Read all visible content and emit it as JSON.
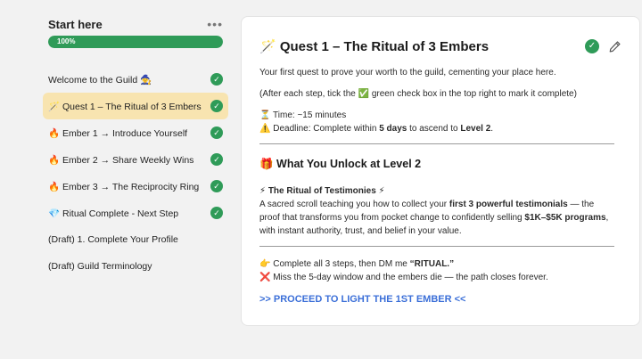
{
  "sidebar": {
    "title": "Start here",
    "more_icon": "•••",
    "progress": {
      "percent": 100,
      "label": "100%"
    },
    "items": [
      {
        "label": "Welcome to the Guild 🧙",
        "done": true,
        "active": false
      },
      {
        "label": "🪄 Quest 1 – The Ritual of 3 Embers",
        "done": true,
        "active": true
      },
      {
        "label": "🔥 Ember 1 → Introduce Yourself",
        "done": true,
        "active": false
      },
      {
        "label": "🔥 Ember 2 → Share Weekly Wins",
        "done": true,
        "active": false
      },
      {
        "label": "🔥 Ember 3 → The Reciprocity Ring",
        "done": true,
        "active": false
      },
      {
        "label": "💎 Ritual Complete - Next Step",
        "done": true,
        "active": false
      },
      {
        "label": "(Draft) 1. Complete Your Profile",
        "done": false,
        "active": false
      },
      {
        "label": "(Draft) Guild Terminology",
        "done": false,
        "active": false
      }
    ],
    "check_glyph": "✓"
  },
  "lesson": {
    "title": "🪄 Quest 1 – The Ritual of 3 Embers",
    "check_glyph": "✓",
    "intro": "Your first quest to prove your worth to the guild, cementing your place here.",
    "instruction": "(After each step, tick the ✅ green check box in the top right to mark it complete)",
    "time": "⏳ Time: ~15 minutes",
    "deadline_pre": "⚠️ Deadline: Complete within ",
    "deadline_days": "5 days",
    "deadline_mid": " to ascend to ",
    "deadline_level": "Level 2",
    "deadline_end": ".",
    "unlock_heading": "🎁 What You Unlock at Level 2",
    "testimonies_pre": "⚡ ",
    "testimonies_title": "The Ritual of Testimonies",
    "testimonies_post": " ⚡",
    "scroll_pre": "A sacred scroll teaching you how to collect your ",
    "scroll_bold1": "first 3 powerful testimonials",
    "scroll_mid": " — the proof that transforms you from pocket change to confidently selling ",
    "scroll_bold2": "$1K–$5K programs",
    "scroll_end": ", with instant authority, trust, and belief in your value.",
    "dm_pre": "👉 Complete all 3 steps, then DM me ",
    "dm_bold": "“RITUAL.”",
    "miss": "❌ Miss the 5-day window and the embers die — the path closes forever.",
    "cta": ">> PROCEED TO LIGHT THE 1ST EMBER <<"
  }
}
